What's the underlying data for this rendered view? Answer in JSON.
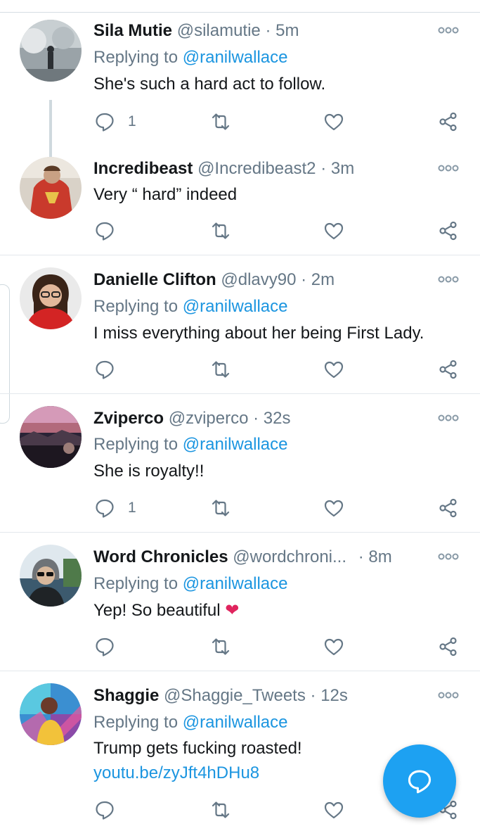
{
  "replying_prefix": "Replying to",
  "separator": "·",
  "tweets": [
    {
      "name": "Sila Mutie",
      "handle": "@silamutie",
      "time": "5m",
      "reply_to": "@ranilwallace",
      "text": "She's such a hard act to follow.",
      "reply_count": "1"
    },
    {
      "name": "Incredibeast",
      "handle": "@Incredibeast2",
      "time": "3m",
      "text": "Very “ hard” indeed"
    },
    {
      "name": "Danielle Clifton",
      "handle": "@dlavy90",
      "time": "2m",
      "reply_to": "@ranilwallace",
      "text": "I miss everything about her being First Lady."
    },
    {
      "name": "Zviperco",
      "handle": "@zviperco",
      "time": "32s",
      "reply_to": "@ranilwallace",
      "text": "She is royalty!!",
      "reply_count": "1"
    },
    {
      "name": "Word Chronicles",
      "handle": "@wordchroni...",
      "time": "8m",
      "reply_to": "@ranilwallace",
      "text": "Yep! So beautiful",
      "emoji": "❤"
    },
    {
      "name": "Shaggie",
      "handle": "@Shaggie_Tweets",
      "time": "12s",
      "reply_to": "@ranilwallace",
      "text": "Trump gets fucking roasted!",
      "link": "youtu.be/zyJft4hDHu8"
    }
  ],
  "icons": {
    "reply": "speech-bubble-icon",
    "retweet": "retweet-arrows-icon",
    "like": "heart-outline-icon",
    "share": "share-nodes-icon",
    "more": "three-dots-icon",
    "compose": "compose-reply-icon"
  },
  "colors": {
    "link": "#1b95e0",
    "muted": "#657786",
    "text": "#14171a",
    "fab": "#1da1f2",
    "heart": "#e0245e"
  }
}
